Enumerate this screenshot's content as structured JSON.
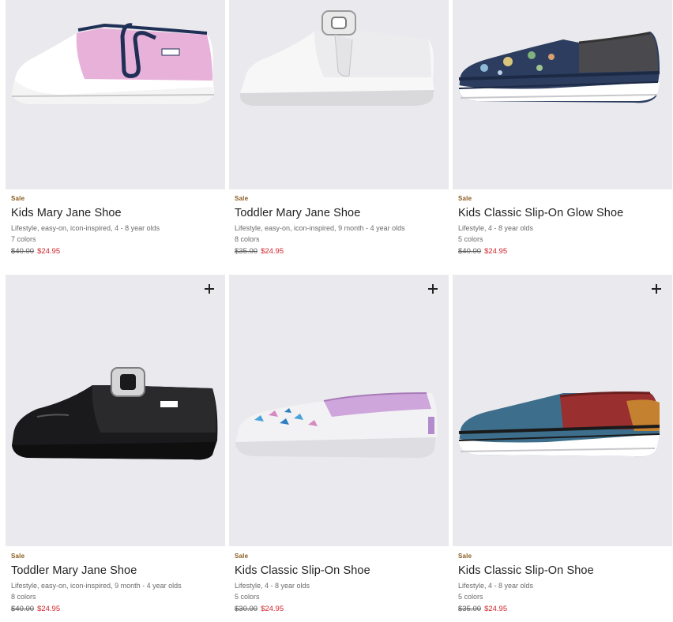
{
  "products": [
    {
      "badge": "Sale",
      "name": "Kids Mary Jane Shoe",
      "description": "Lifestyle, easy-on, icon-inspired, 4 - 8 year olds",
      "colors": "7 colors",
      "original_price": "$40.00",
      "sale_price": "$24.95",
      "image_alt": "pink-mary-jane-shoe"
    },
    {
      "badge": "Sale",
      "name": "Toddler Mary Jane Shoe",
      "description": "Lifestyle, easy-on, icon-inspired, 9 month - 4 year olds",
      "colors": "8 colors",
      "original_price": "$35.00",
      "sale_price": "$24.95",
      "image_alt": "white-mary-jane-shoe"
    },
    {
      "badge": "Sale",
      "name": "Kids Classic Slip-On Glow Shoe",
      "description": "Lifestyle, 4 - 8 year olds",
      "colors": "5 colors",
      "original_price": "$40.00",
      "sale_price": "$24.95",
      "image_alt": "dinosaur-print-slip-on-shoe"
    },
    {
      "badge": "Sale",
      "name": "Toddler Mary Jane Shoe",
      "description": "Lifestyle, easy-on, icon-inspired, 9 month - 4 year olds",
      "colors": "8 colors",
      "original_price": "$40.00",
      "sale_price": "$24.95",
      "image_alt": "black-patent-mary-jane-shoe"
    },
    {
      "badge": "Sale",
      "name": "Kids Classic Slip-On Shoe",
      "description": "Lifestyle, 4 - 8 year olds",
      "colors": "5 colors",
      "original_price": "$30.00",
      "sale_price": "$24.95",
      "image_alt": "butterfly-slip-on-shoe"
    },
    {
      "badge": "Sale",
      "name": "Kids Classic Slip-On Shoe",
      "description": "Lifestyle, 4 - 8 year olds",
      "colors": "5 colors",
      "original_price": "$35.00",
      "sale_price": "$24.95",
      "image_alt": "blue-red-slip-on-shoe"
    }
  ],
  "colors": {
    "sale_badge": "#8a5a1d",
    "sale_price": "#d0242b",
    "card_background": "#eaeaee"
  },
  "icons": {
    "quick_add": "plus-icon"
  }
}
